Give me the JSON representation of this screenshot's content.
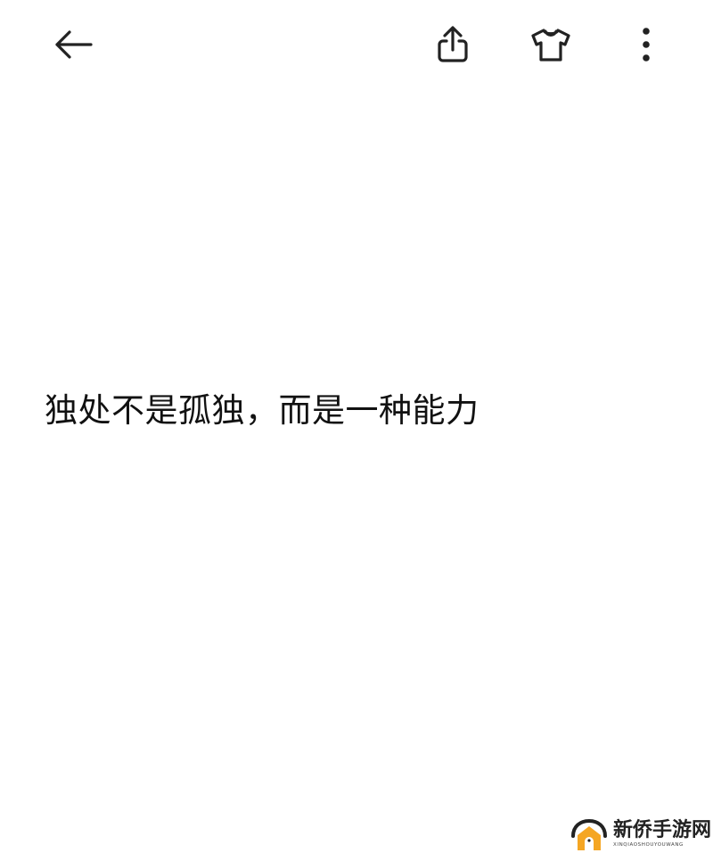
{
  "toolbar": {
    "back_icon": "arrow-left-icon",
    "share_icon": "share-icon",
    "theme_icon": "tshirt-icon",
    "more_icon": "more-vertical-icon",
    "icon_color": "#222222"
  },
  "note": {
    "text": "独处不是孤独，而是一种能力"
  },
  "watermark": {
    "title": "新侨手游网",
    "subtitle": "XINQIAOSHOUYOUWANG",
    "logo_color": "#f5a623"
  }
}
